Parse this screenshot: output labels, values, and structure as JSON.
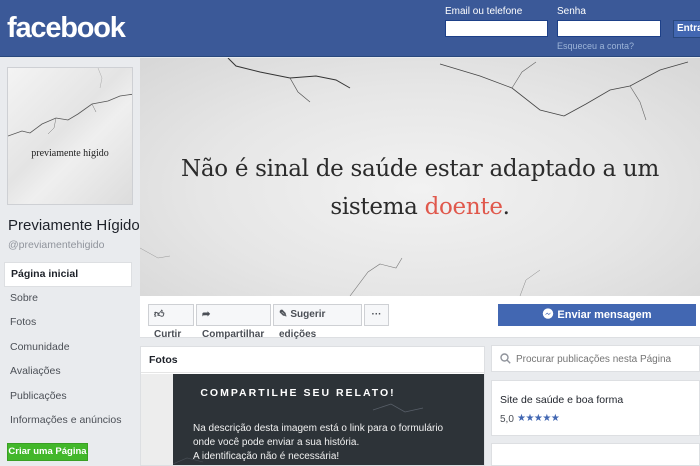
{
  "header": {
    "logo": "facebook",
    "email_label": "Email ou telefone",
    "password_label": "Senha",
    "email_value": "",
    "password_value": "",
    "forgot_link": "Esqueceu a conta?",
    "login_button": "Entrar"
  },
  "profile": {
    "picture_text": "previamente hígido",
    "name": "Previamente Hígido",
    "handle": "@previamentehigido"
  },
  "nav": {
    "items": [
      {
        "label": "Página inicial"
      },
      {
        "label": "Sobre"
      },
      {
        "label": "Fotos"
      },
      {
        "label": "Comunidade"
      },
      {
        "label": "Avaliações"
      },
      {
        "label": "Publicações"
      },
      {
        "label": "Informações e anúncios"
      }
    ],
    "create_page": "Criar uma Página"
  },
  "cover": {
    "line1": "Não é sinal de saúde estar adaptado a um",
    "line2_prefix": "sistema ",
    "line2_accent": "doente",
    "line2_suffix": "."
  },
  "actions": {
    "like": "Curtir",
    "share": "Compartilhar",
    "suggest": "Sugerir edições",
    "more": "···",
    "send_message": "Enviar mensagem"
  },
  "photos": {
    "title": "Fotos",
    "heading": "COMPARTILHE SEU RELATO!",
    "body_line1": "Na descrição desta imagem  está o link para o  formulário",
    "body_line2": "onde você pode enviar a sua história.",
    "body_line3": "A identificação não é necessária!"
  },
  "sidebar": {
    "search_placeholder": "Procurar publicações nesta Página",
    "about_title": "Site de saúde e boa forma",
    "rating_value": "5,0",
    "stars": "★★★★★"
  },
  "colors": {
    "brand": "#3b5998",
    "button_blue": "#4267b2",
    "create_green": "#42b72a",
    "accent_red": "#e0584c"
  }
}
